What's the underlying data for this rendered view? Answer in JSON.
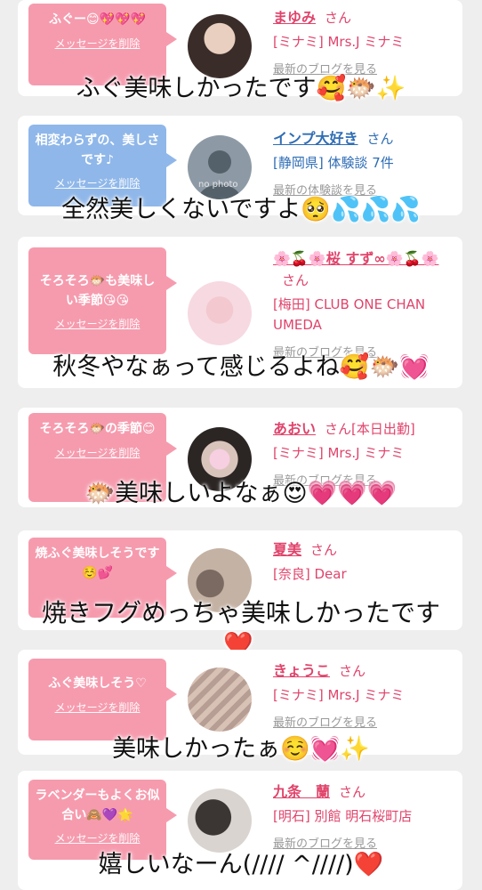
{
  "common": {
    "san": "さん",
    "delete": "メッセージを削除",
    "latest_blog": "最新のブログを見る",
    "latest_experience": "最新の体験談を見る"
  },
  "cards": [
    {
      "bubble": "ふぐー😊💖💖💖",
      "name": "まゆみ",
      "shop": "[ミナミ] Mrs.J ミナミ",
      "link_key": "blog",
      "overlay": "ふぐ美味しかったです🥰🐡✨"
    },
    {
      "bubble": "相変わらずの、美しさです♪",
      "name": "インプ大好き",
      "shop": "[静岡県] 体験談 7件",
      "link_key": "experience",
      "overlay": "全然美しくないですよ🥺💦💦💦",
      "avatar_text": "no photo"
    },
    {
      "bubble": "そろそろ🐡も美味しい季節😘😘",
      "name": "🌸🍒🌸桜 すず∞🌸🍒🌸",
      "shop": "[梅田] CLUB ONE CHAN UMEDA",
      "link_key": "blog",
      "overlay": "秋冬やなぁって感じるよね🥰🐡💓"
    },
    {
      "bubble": "そろそろ🐡の季節😊",
      "name": "あおい",
      "name_suffix": "[本日出勤]",
      "shop": "[ミナミ] Mrs.J ミナミ",
      "link_key": "blog",
      "overlay": "🐡美味しいよなぁ😍💗💗💗"
    },
    {
      "bubble": "焼ふぐ美味しそうです☺️💕",
      "name": "夏美",
      "shop": "[奈良] Dear",
      "link_key": "blog",
      "overlay": "焼きフグめっちゃ美味しかったです",
      "overlay2": "❤️"
    },
    {
      "bubble": "ふぐ美味しそう♡",
      "name": "きょうこ",
      "shop": "[ミナミ] Mrs.J ミナミ",
      "link_key": "blog",
      "overlay": "美味しかったぁ☺️💓✨"
    },
    {
      "bubble": "ラベンダーもよくお似合い🙈💜🌟",
      "name": "九条　蘭",
      "shop": "[明石] 別館 明石桜町店",
      "link_key": "blog",
      "overlay": "嬉しいなーん(//// ^////)❤️"
    }
  ],
  "colors": {
    "pink_bubble": "#f69bae",
    "blue_bubble": "#8fb7e9",
    "pink_text": "#e0446b",
    "blue_text": "#2f6db5"
  }
}
